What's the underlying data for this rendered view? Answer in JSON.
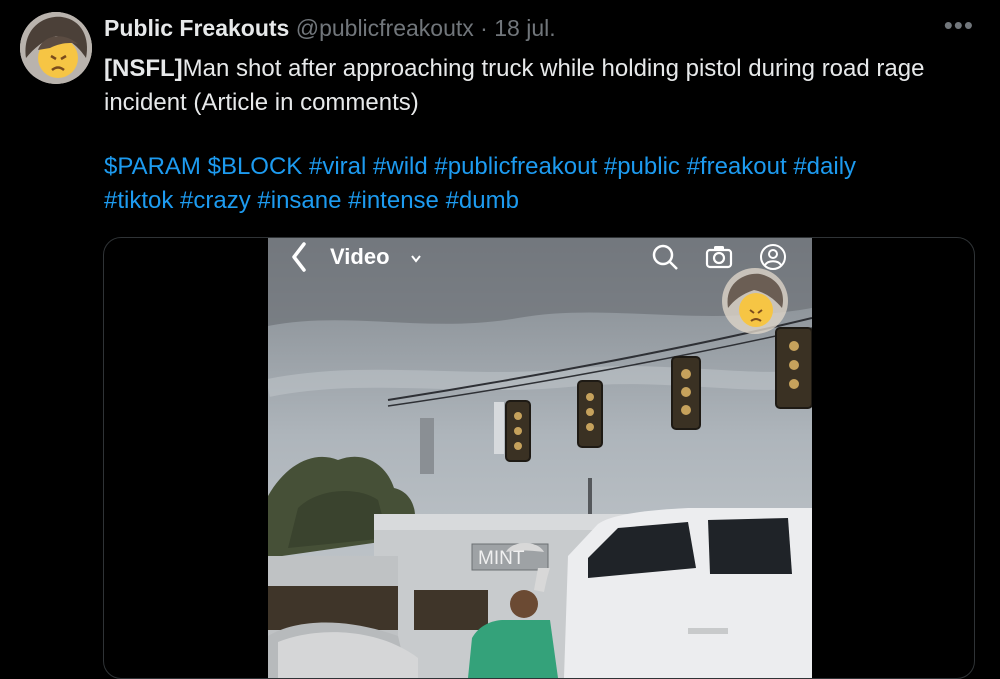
{
  "tweet": {
    "author_name": "Public Freakouts",
    "handle": "@publicfreakoutx",
    "separator": "·",
    "date": "18 jul.",
    "more_label": "•••",
    "text_bold": "[NSFL]",
    "text_rest": "Man shot after approaching truck while holding pistol during road rage incident (Article in comments)",
    "tags": [
      "$PARAM",
      "$BLOCK",
      "#viral",
      "#wild",
      "#publicfreakout",
      "#public",
      "#freakout",
      "#daily",
      "#tiktok",
      "#crazy",
      "#insane",
      "#intense",
      "#dumb"
    ]
  },
  "video": {
    "back_label": "‹",
    "title": "Video",
    "title_caret": "⌄",
    "icons": [
      "search-icon",
      "camera-icon",
      "profile-icon"
    ],
    "store_sign": "MINT"
  },
  "colors": {
    "background": "#000000",
    "text": "#e7e9ea",
    "muted": "#71767b",
    "link": "#1d9bf0",
    "border": "#2f3336"
  }
}
